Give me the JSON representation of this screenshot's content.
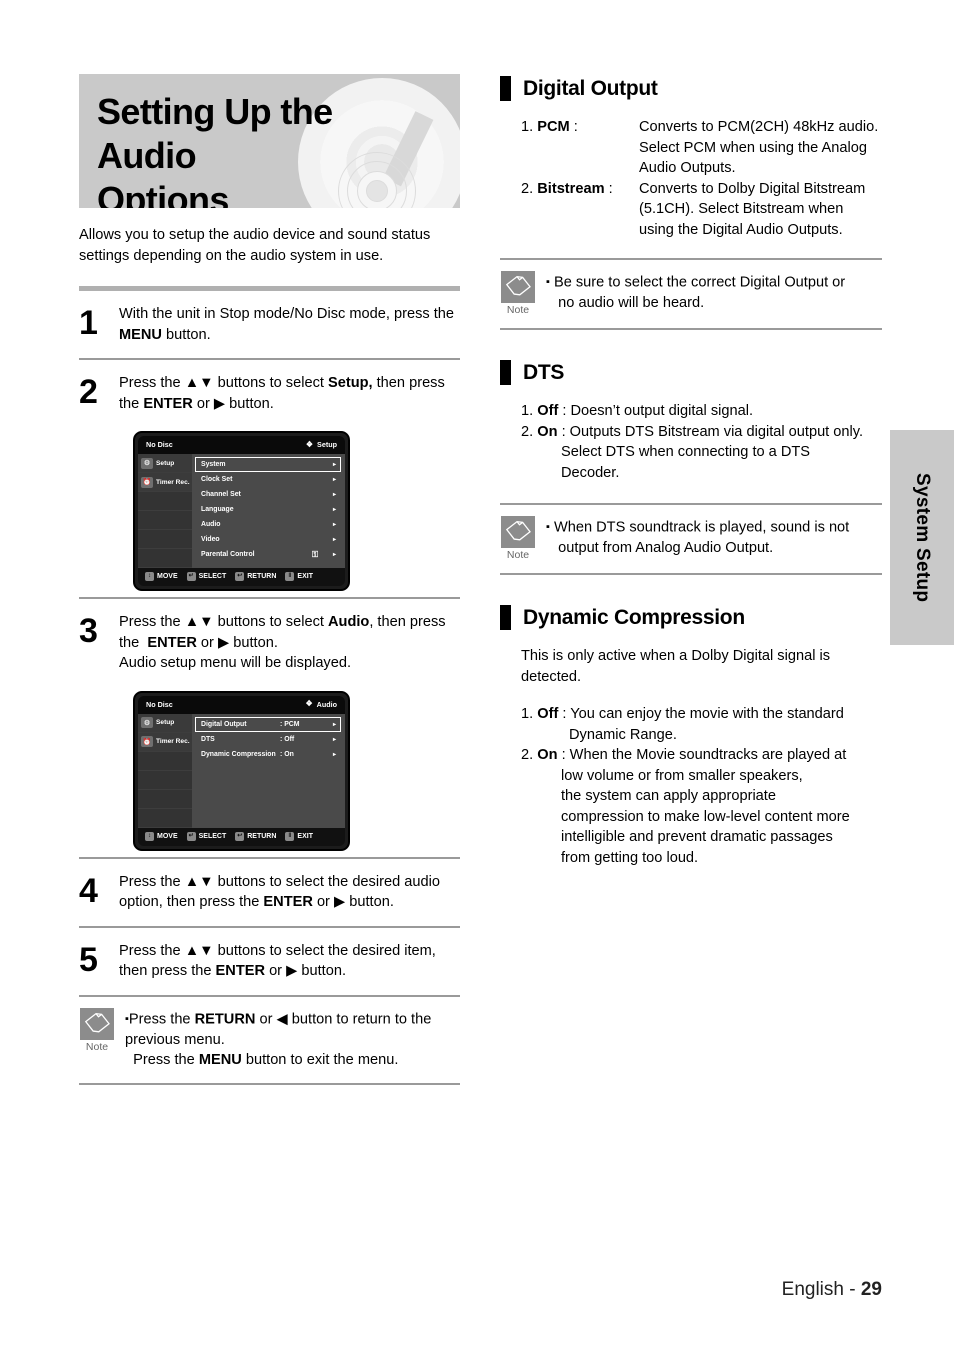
{
  "header": {
    "title_line1": "Setting Up the Audio",
    "title_line2": "Options",
    "intro": "Allows you to setup the audio device and sound status settings depending on the audio system in use."
  },
  "steps": [
    {
      "num": "1",
      "html": "With the unit in Stop mode/No Disc mode, press the <b>MENU</b> button."
    },
    {
      "num": "2",
      "html": "Press the ▲▼ buttons to select <b>Setup,</b> then press the <b>ENTER</b> or ▶ button."
    },
    {
      "num": "3",
      "html": "Press the ▲▼ buttons to select <b>Audio</b>, then press the&nbsp; <b>ENTER</b> or ▶ button.<br>Audio setup menu will be displayed."
    },
    {
      "num": "4",
      "html": "Press the ▲▼ buttons to select the desired audio option, then press the <b>ENTER</b> or ▶ button."
    },
    {
      "num": "5",
      "html": "Press the ▲▼ buttons to select the desired item, then press the <b>ENTER</b> or ▶ button."
    }
  ],
  "osd_setup": {
    "status": "No Disc",
    "screen_name": "Setup",
    "compass_icon": "compass-icon",
    "sidebar": [
      {
        "label": "Setup",
        "icon": "gear-icon"
      },
      {
        "label": "Timer Rec.",
        "icon": "timer-icon"
      }
    ],
    "rows": [
      {
        "name": "System",
        "selected": true,
        "arrow": "▸"
      },
      {
        "name": "Clock Set",
        "selected": false,
        "arrow": "▸"
      },
      {
        "name": "Channel Set",
        "selected": false,
        "arrow": "▸"
      },
      {
        "name": "Language",
        "selected": false,
        "arrow": "▸"
      },
      {
        "name": "Audio",
        "selected": false,
        "arrow": "▸"
      },
      {
        "name": "Video",
        "selected": false,
        "arrow": "▸"
      },
      {
        "name": "Parental Control",
        "selected": false,
        "lock": "⚿",
        "arrow": "▸"
      }
    ],
    "footer": [
      {
        "label": "MOVE",
        "icon": "updown-icon",
        "glyph": "↕"
      },
      {
        "label": "SELECT",
        "icon": "enter-icon",
        "glyph": "↵"
      },
      {
        "label": "RETURN",
        "icon": "return-icon",
        "glyph": "↩"
      },
      {
        "label": "EXIT",
        "icon": "exit-icon",
        "glyph": "‖"
      }
    ]
  },
  "osd_audio": {
    "status": "No Disc",
    "screen_name": "Audio",
    "compass_icon": "compass-icon",
    "sidebar": [
      {
        "label": "Setup",
        "icon": "gear-icon"
      },
      {
        "label": "Timer Rec.",
        "icon": "timer-icon"
      }
    ],
    "rows": [
      {
        "name": "Digital Output",
        "value": ": PCM",
        "selected": true,
        "arrow": "▸"
      },
      {
        "name": "DTS",
        "value": ": Off",
        "selected": false,
        "arrow": "▸"
      },
      {
        "name": "Dynamic Compression",
        "value": ": On",
        "selected": false,
        "arrow": "▸"
      }
    ],
    "footer": [
      {
        "label": "MOVE",
        "icon": "updown-icon",
        "glyph": "↕"
      },
      {
        "label": "SELECT",
        "icon": "enter-icon",
        "glyph": "↵"
      },
      {
        "label": "RETURN",
        "icon": "return-icon",
        "glyph": "↩"
      },
      {
        "label": "EXIT",
        "icon": "exit-icon",
        "glyph": "‖"
      }
    ]
  },
  "note_left": {
    "word": "Note",
    "icon": "pencil-icon",
    "html": "<span class=\"bullet-sq\">▪</span>Press the <b>RETURN</b> or ◀ button to return to the previous menu.<br>&nbsp;&nbsp;Press the <b>MENU</b> button to exit the menu."
  },
  "sections": {
    "digital_output": {
      "title": "Digital Output",
      "items": [
        {
          "term": "1. <b>PCM</b> :",
          "desc": "Converts to PCM(2CH) 48kHz audio. Select PCM when using the Analog Audio Outputs."
        },
        {
          "term": "2. <b>Bitstream</b> :",
          "desc": "Converts to Dolby Digital Bitstream (5.1CH). Select Bitstream when using the Digital Audio Outputs."
        }
      ],
      "note": {
        "word": "Note",
        "icon": "pencil-icon",
        "html": "<span class=\"bullet-sq\">▪</span> Be sure to select the correct Digital Output or<br>&nbsp;&nbsp;&nbsp;no audio will be heard."
      }
    },
    "dts": {
      "title": "DTS",
      "lines": [
        "1. <b>Off</b> : Doesn’t output digital signal.",
        "2. <b>On</b> : Outputs DTS Bitstream via digital output only.",
        "Select DTS when connecting to a DTS",
        "Decoder."
      ],
      "note": {
        "word": "Note",
        "icon": "pencil-icon",
        "html": "<span class=\"bullet-sq\">▪</span> When DTS soundtrack is played, sound is not<br>&nbsp;&nbsp;&nbsp;output from Analog Audio Output."
      }
    },
    "dynamic_compression": {
      "title": "Dynamic Compression",
      "paragraph": "This is only active when a Dolby Digital signal is detected.",
      "lines": [
        "1. <b>Off</b> : You can enjoy the movie with the standard",
        "Dynamic Range.",
        "2. <b>On</b> : When the Movie soundtracks are played at",
        "low volume or from smaller speakers,",
        "the system can apply appropriate",
        "compression to make low-level content more",
        "intelligible and prevent dramatic passages",
        "from getting too loud."
      ]
    }
  },
  "side_tab": {
    "label": "System Setup"
  },
  "footer": {
    "language": "English - ",
    "page": "29"
  }
}
